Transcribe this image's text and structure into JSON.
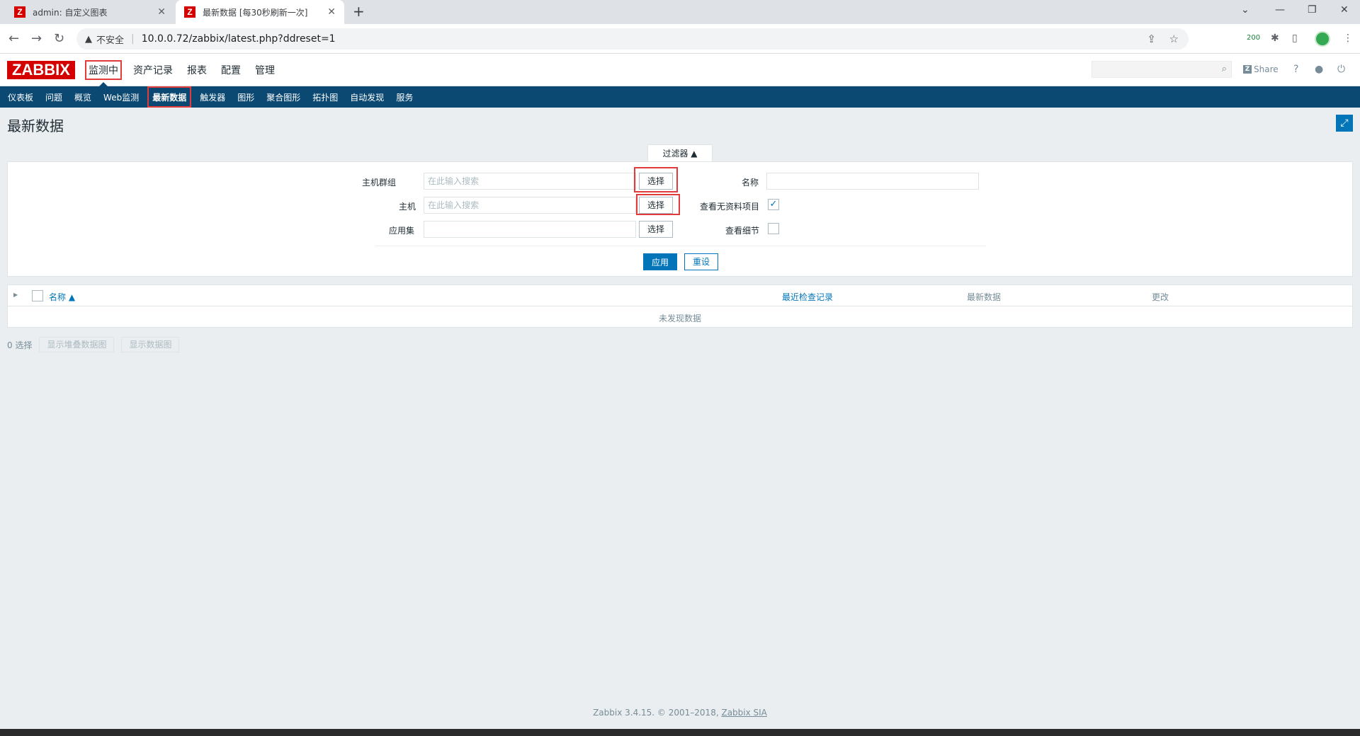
{
  "browser": {
    "tabs": [
      {
        "title": "admin: 自定义图表",
        "favicon": "Z"
      },
      {
        "title": "最新数据 [每30秒刷新一次]",
        "favicon": "Z"
      }
    ],
    "address": {
      "security": "不安全",
      "url": "10.0.0.72/zabbix/latest.php?ddreset=1"
    },
    "ext_badge": "200"
  },
  "zabbix": {
    "logo": "ZABBIX",
    "top_menu": [
      "监测中",
      "资产记录",
      "报表",
      "配置",
      "管理"
    ],
    "share": "Share",
    "sub_menu": [
      "仪表板",
      "问题",
      "概览",
      "Web监测",
      "最新数据",
      "触发器",
      "图形",
      "聚合图形",
      "拓扑图",
      "自动发现",
      "服务"
    ],
    "page_title": "最新数据",
    "filter": {
      "tab_label": "过滤器 ▲",
      "host_group_label": "主机群组",
      "host_group_placeholder": "在此输入搜索",
      "host_label": "主机",
      "host_placeholder": "在此输入搜索",
      "application_label": "应用集",
      "select_label": "选择",
      "name_label": "名称",
      "show_without_data_label": "查看无资料项目",
      "show_details_label": "查看细节",
      "apply_label": "应用",
      "reset_label": "重设"
    },
    "table": {
      "col_name": "名称 ▲",
      "col_last_check": "最近检查记录",
      "col_last_value": "最新数据",
      "col_change": "更改",
      "no_data": "未发现数据"
    },
    "actions": {
      "selected_count": "0 选择",
      "stacked_graph": "显示堆叠数据图",
      "graph": "显示数据图"
    },
    "footer": {
      "prefix": "Zabbix 3.4.15. © 2001–2018, ",
      "link": "Zabbix SIA"
    }
  },
  "colors": {
    "brand": "#d40000",
    "nav": "#0b4972",
    "accent": "#0275b8",
    "highlight": "#e23b3b"
  }
}
